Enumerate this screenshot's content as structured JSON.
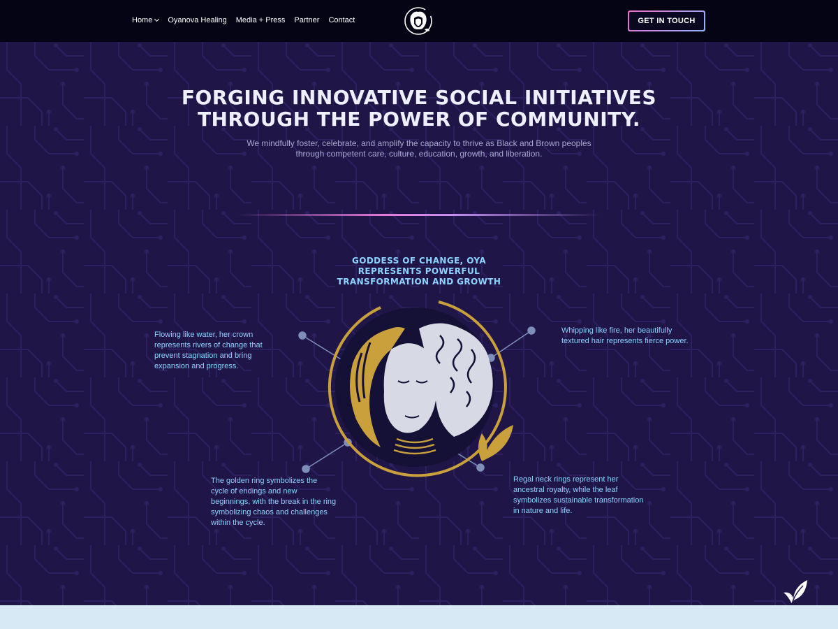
{
  "header": {
    "nav": [
      {
        "label": "Home",
        "has_dropdown": true
      },
      {
        "label": "Oyanova Healing"
      },
      {
        "label": "Media + Press"
      },
      {
        "label": "Partner"
      },
      {
        "label": "Contact"
      }
    ],
    "logo_icon": "oya-goddess-logo",
    "cta_label": "GET IN TOUCH"
  },
  "hero": {
    "headline_line1": "FORGING INNOVATIVE SOCIAL INITIATIVES",
    "headline_line2": "THROUGH THE POWER OF COMMUNITY.",
    "subtext_line1": "We mindfully foster, celebrate, and amplify the capacity to thrive as Black and Brown peoples",
    "subtext_line2": "through competent care, culture, education, growth, and liberation."
  },
  "emblem": {
    "title_line1": "GODDESS OF CHANGE, OYA",
    "title_line2": "REPRESENTS POWERFUL",
    "title_line3": "TRANSFORMATION AND GROWTH",
    "captions": {
      "top_left": "Flowing like water, her crown represents rivers of change that prevent stagnation and bring expansion and progress.",
      "top_right": "Whipping like fire, her beautifully textured hair represents fierce power.",
      "bottom_left": "The golden ring symbolizes the cycle of endings and new beginnings, with the break in the ring symbolizing chaos and challenges within the cycle.",
      "bottom_right": "Regal neck rings represent her ancestral royalty, while the leaf symbolizes sustainable transformation in nature and life."
    }
  },
  "colors": {
    "nav_bg": "#050414",
    "hero_bg": "#1f1547",
    "accent_blue": "#8ed3ff",
    "gold": "#c9a03c",
    "bottom_band": "#d8e9f6"
  },
  "floating_icon": "leaf-icon"
}
